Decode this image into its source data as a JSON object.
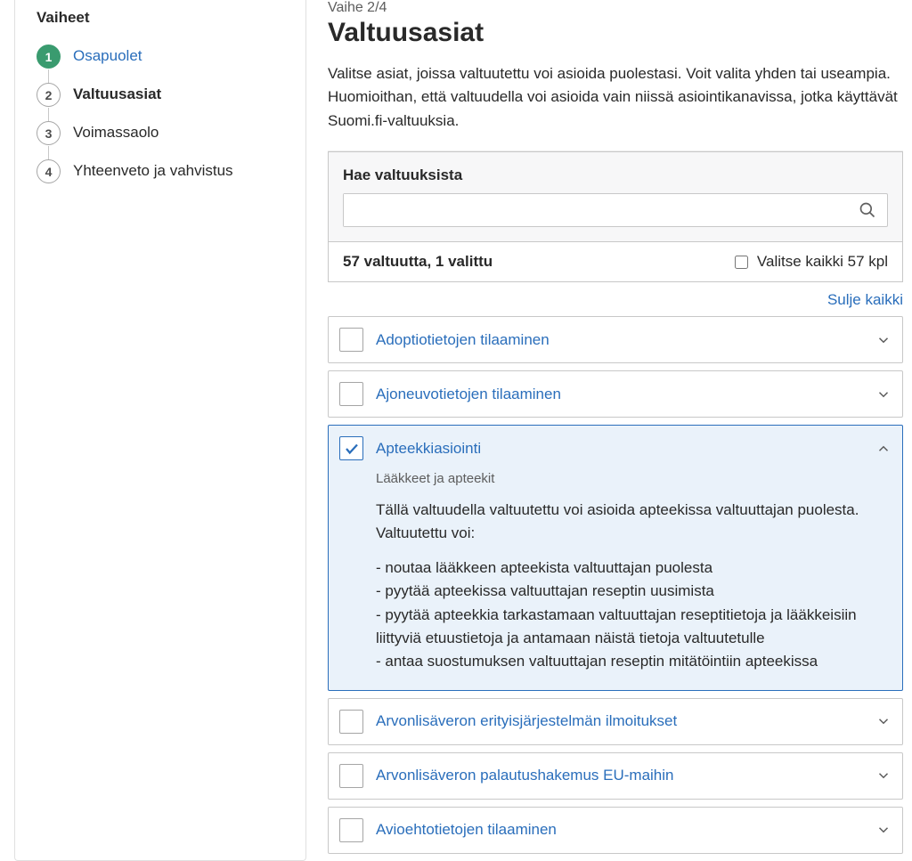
{
  "sidebar": {
    "title": "Vaiheet",
    "steps": [
      {
        "num": "1",
        "label": "Osapuolet"
      },
      {
        "num": "2",
        "label": "Valtuusasiat"
      },
      {
        "num": "3",
        "label": "Voimassaolo"
      },
      {
        "num": "4",
        "label": "Yhteenveto ja vahvistus"
      }
    ]
  },
  "main": {
    "stepcounter": "Vaihe 2/4",
    "title": "Valtuusasiat",
    "intro": "Valitse asiat, joissa valtuutettu voi asioida puolestasi. Voit valita yhden tai useampia. Huomioithan, että valtuudella voi asioida vain niissä asiointikanavissa, jotka käyttävät Suomi.fi-valtuuksia.",
    "search": {
      "label": "Hae valtuuksista",
      "value": "",
      "placeholder": ""
    },
    "count_text": "57 valtuutta, 1 valittu",
    "select_all_label": "Valitse kaikki 57 kpl",
    "close_all": "Sulje kaikki",
    "items": [
      {
        "title": "Adoptiotietojen tilaaminen"
      },
      {
        "title": "Ajoneuvotietojen tilaaminen"
      },
      {
        "title": "Apteekkiasiointi"
      },
      {
        "title": "Arvonlisäveron erityisjärjestelmän ilmoitukset"
      },
      {
        "title": "Arvonlisäveron palautushakemus EU-maihin"
      },
      {
        "title": "Avioehtotietojen tilaaminen"
      }
    ],
    "expanded": {
      "category": "Lääkkeet ja apteekit",
      "desc": "Tällä valtuudella valtuutettu voi asioida apteekissa valtuuttajan puolesta. Valtuutettu voi:",
      "bullets": [
        "- noutaa lääkkeen apteekista valtuuttajan puolesta",
        "- pyytää apteekissa valtuuttajan reseptin uusimista",
        "- pyytää apteekkia tarkastamaan valtuuttajan reseptitietoja ja lääkkeisiin liittyviä etuustietoja ja antamaan näistä tietoja valtuutetulle",
        "- antaa suostumuksen valtuuttajan reseptin mitätöintiin apteekissa"
      ]
    }
  }
}
